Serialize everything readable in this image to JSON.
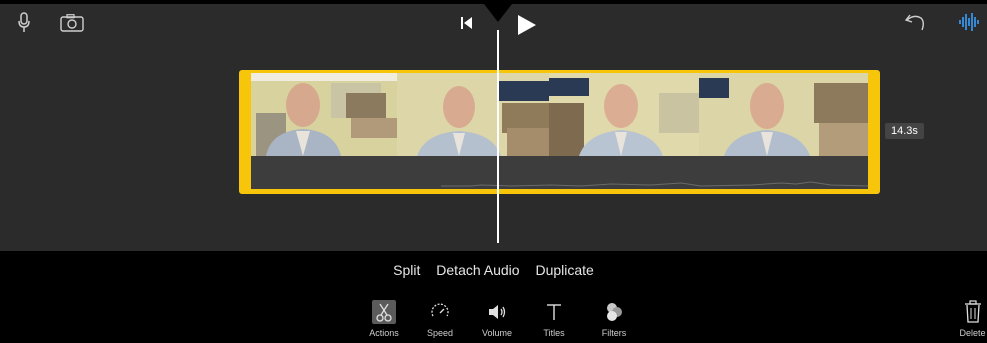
{
  "clip": {
    "duration": "14.3s"
  },
  "clip_actions": [
    "Split",
    "Detach Audio",
    "Duplicate"
  ],
  "toolbar": {
    "items": [
      {
        "label": "Actions",
        "icon": "scissors-icon",
        "active": true
      },
      {
        "label": "Speed",
        "icon": "speedometer-icon",
        "active": false
      },
      {
        "label": "Volume",
        "icon": "speaker-icon",
        "active": false
      },
      {
        "label": "Titles",
        "icon": "text-t-icon",
        "active": false
      },
      {
        "label": "Filters",
        "icon": "filters-circles-icon",
        "active": false
      }
    ],
    "delete_label": "Delete"
  },
  "colors": {
    "timeline_bg": "#2b2b2b",
    "clip_border": "#f7c60a",
    "waveform_accent": "#3aa0ff"
  }
}
